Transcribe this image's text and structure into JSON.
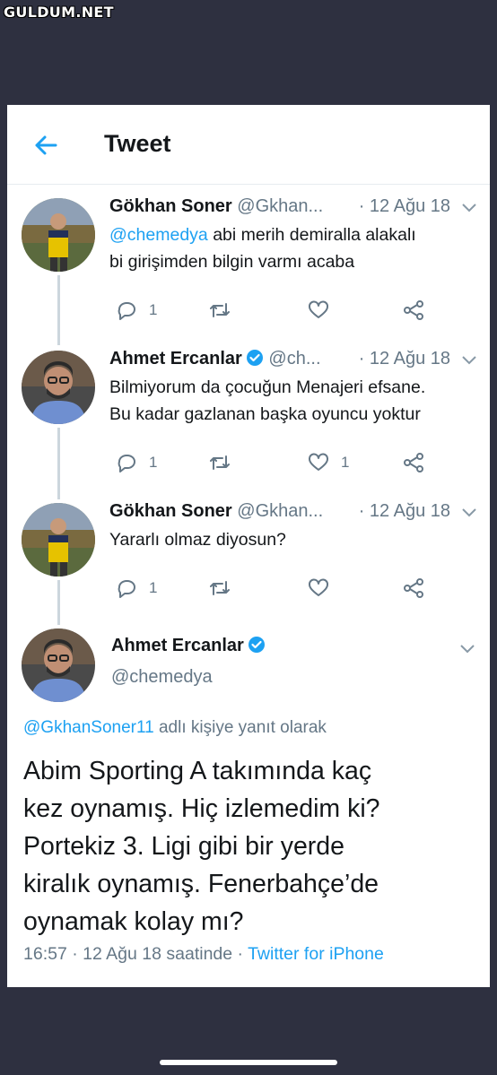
{
  "watermark": "GULDUM.NET",
  "header": {
    "title": "Tweet"
  },
  "tweets": [
    {
      "name": "Gökhan Soner",
      "handle": "@Gkhan...",
      "date": "· 12 Ağu 18",
      "mention": "@chemedya",
      "text_lines": [
        "abi merih demiralla alakalı",
        "bi girişimden bilgin varmı acaba"
      ],
      "replies": "1",
      "retweets": "",
      "likes": ""
    },
    {
      "name": "Ahmet Ercanlar",
      "handle": "@ch...",
      "date": "· 12 Ağu 18",
      "text_lines": [
        "Bilmiyorum da çocuğun Menajeri efsane.",
        "Bu kadar gazlanan başka oyuncu yoktur"
      ],
      "replies": "1",
      "retweets": "",
      "likes": "1"
    },
    {
      "name": "Gökhan Soner",
      "handle": "@Gkhan...",
      "date": "· 12 Ağu 18",
      "text_lines": [
        "Yararlı olmaz diyosun?"
      ],
      "replies": "1",
      "retweets": "",
      "likes": ""
    }
  ],
  "main_tweet": {
    "name": "Ahmet Ercanlar",
    "handle": "@chemedya",
    "reply_mention": "@GkhanSoner11",
    "reply_suffix": " adlı kişiye yanıt olarak",
    "text_lines": [
      "Abim Sporting A takımında kaç",
      "kez oynamış. Hiç izlemedim ki?",
      "Portekiz 3. Ligi gibi bir yerde",
      "kiralık oynamış. Fenerbahçe’de",
      "oynamak kolay mı?"
    ],
    "time": "16:57 · 12 Ağu 18 saatinde · ",
    "source": "Twitter for iPhone"
  },
  "colors": {
    "accent": "#1da1f2",
    "muted": "#657786",
    "text": "#14171a",
    "frame": "#2e3040"
  },
  "icons": [
    "back-arrow-icon",
    "verified-badge-icon",
    "chevron-down-icon",
    "reply-icon",
    "retweet-icon",
    "like-icon",
    "share-icon"
  ]
}
